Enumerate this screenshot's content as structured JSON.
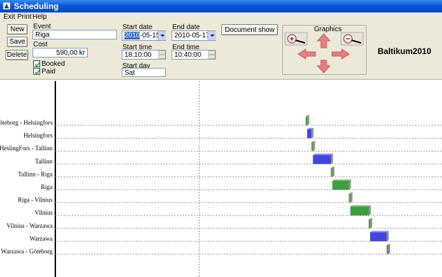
{
  "window": {
    "title": "Scheduling"
  },
  "menu": [
    "Exit",
    "Print",
    "Help"
  ],
  "buttons": {
    "new": "New",
    "save": "Save",
    "delete": "Delete",
    "document_show": "Document show"
  },
  "form": {
    "event_label": "Event",
    "event_value": "Riga",
    "cost_label": "Cost",
    "cost_value": "590,00 kr",
    "booked_label": "Booked",
    "booked_checked": true,
    "paid_label": "Paid",
    "paid_checked": true,
    "start_date_label": "Start date",
    "start_date_sel": "2010",
    "start_date_rest": "-05-15",
    "end_date_label": "End date",
    "end_date_value": "2010-05-17",
    "start_time_label": "Start time",
    "start_time_value": "18:10:00",
    "end_time_label": "End time",
    "end_time_value": "10:40:00",
    "start_day_label": "Start day",
    "start_day_value": "Sat"
  },
  "graphics": {
    "label": "Graphics",
    "zoom_in_icon": "zoom-in-icon",
    "zoom_out_icon": "zoom-out-icon"
  },
  "brand": "Baltikum2010",
  "chart_data": {
    "type": "gantt",
    "rows": [
      "Göteborg - Helsingfors",
      "Helsingfors",
      "HeslingFors - Tallinn",
      "Tallinn",
      "Tallinn - Riga",
      "Riga",
      "Riga - Vilnius",
      "Vilnius",
      "Vilnius - Warzawa",
      "Warzawa",
      "Warzawa - Göteborg"
    ],
    "bars": [
      {
        "row": 0,
        "start": 0.0,
        "end": 0.08,
        "kind": "travel"
      },
      {
        "row": 1,
        "start": 0.08,
        "end": 0.32,
        "kind": "stay"
      },
      {
        "row": 2,
        "start": 0.32,
        "end": 0.4,
        "kind": "travel"
      },
      {
        "row": 3,
        "start": 0.4,
        "end": 1.4,
        "kind": "stay"
      },
      {
        "row": 4,
        "start": 1.4,
        "end": 1.48,
        "kind": "travel"
      },
      {
        "row": 5,
        "start": 1.48,
        "end": 2.4,
        "kind": "travel"
      },
      {
        "row": 6,
        "start": 2.4,
        "end": 2.48,
        "kind": "travel"
      },
      {
        "row": 7,
        "start": 2.48,
        "end": 3.5,
        "kind": "travel"
      },
      {
        "row": 8,
        "start": 3.5,
        "end": 3.58,
        "kind": "travel"
      },
      {
        "row": 9,
        "start": 3.58,
        "end": 4.5,
        "kind": "stay"
      },
      {
        "row": 10,
        "start": 4.5,
        "end": 4.56,
        "kind": "travel"
      }
    ],
    "colors": {
      "travel": "#3e9e3e",
      "stay": "#4444dd"
    }
  }
}
